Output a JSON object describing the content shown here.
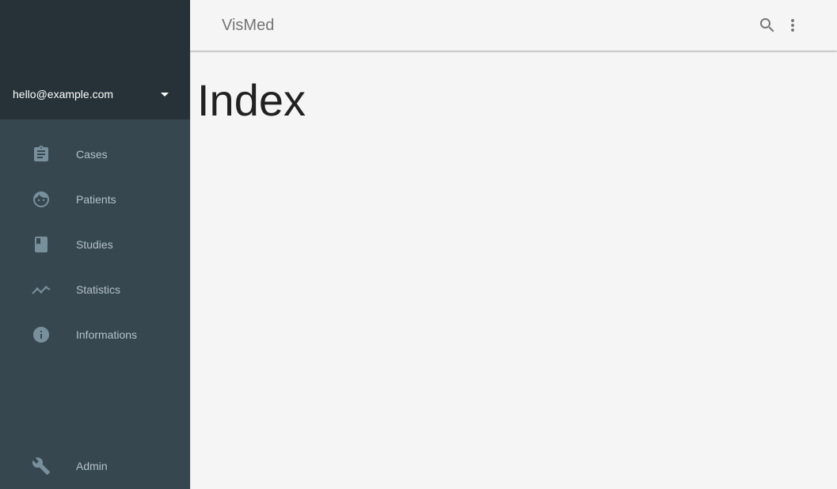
{
  "app": {
    "title": "VisMed"
  },
  "account": {
    "email": "hello@example.com",
    "caret_icon": "arrow-drop-down-icon"
  },
  "sidebar": {
    "items": [
      {
        "label": "Cases",
        "icon": "clipboard-icon"
      },
      {
        "label": "Patients",
        "icon": "face-icon"
      },
      {
        "label": "Studies",
        "icon": "book-icon"
      },
      {
        "label": "Statistics",
        "icon": "trending-icon"
      },
      {
        "label": "Informations",
        "icon": "info-icon"
      }
    ],
    "footer_item": {
      "label": "Admin",
      "icon": "wrench-icon"
    }
  },
  "header": {
    "search_icon": "search-icon",
    "menu_icon": "more-vert-icon"
  },
  "main": {
    "page_title": "Index"
  },
  "colors": {
    "sidebar_bg": "#37474f",
    "drawer_header_bg": "#263238",
    "sidebar_icon": "#78909c",
    "sidebar_text": "#b4c2c9",
    "content_bg": "#f5f5f5",
    "title_text": "#757575"
  }
}
